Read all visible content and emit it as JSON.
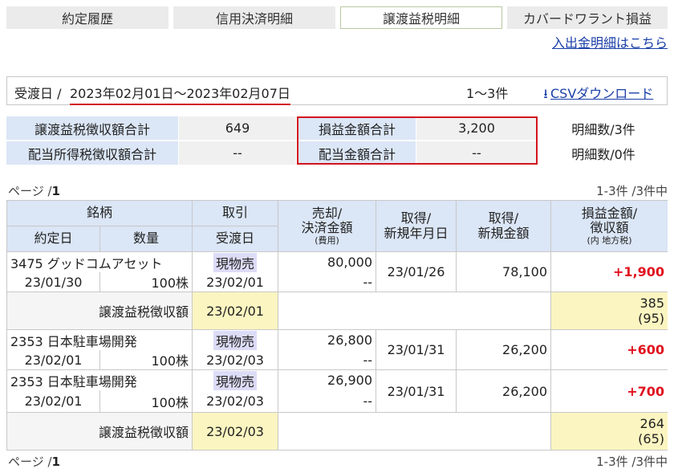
{
  "tabs": [
    {
      "label": "約定履歴"
    },
    {
      "label": "信用決済明細"
    },
    {
      "label": "譲渡益税明細"
    },
    {
      "label": "カバードワラント損益"
    }
  ],
  "links": {
    "deposit": "入出金明細はこちら"
  },
  "period": {
    "label": "受渡日",
    "sep": "/",
    "range": "2023年02月01日～2023年02月07日",
    "count": "1～3件",
    "csv": "CSVダウンロード"
  },
  "summary": {
    "rows": [
      {
        "label1": "譲渡益税徴収額合計",
        "value1": "649",
        "label2": "損益金額合計",
        "value2": "3,200",
        "detail": "明細数/3件"
      },
      {
        "label1": "配当所得税徴収額合計",
        "value1": "--",
        "label2": "配当金額合計",
        "value2": "--",
        "detail": "明細数/0件"
      }
    ]
  },
  "pagination": {
    "page_label": "ページ /",
    "page_num": "1",
    "count": "1-3件 /3件中"
  },
  "table": {
    "headers": {
      "meigara": "銘柄",
      "torihiki": "取引",
      "yakujo_date": "約定日",
      "quantity": "数量",
      "ukewatashi": "受渡日",
      "sell_1": "売却/",
      "sell_2": "決済金額",
      "sell_3": "(費用)",
      "acq_date_1": "取得/",
      "acq_date_2": "新規年月日",
      "acq_amt_1": "取得/",
      "acq_amt_2": "新規金額",
      "pl_1": "損益金額/",
      "pl_2": "徴収額",
      "pl_3": "(内 地方税)"
    },
    "trades": [
      {
        "name": "3475 グッドコムアセット",
        "trade": "現物売",
        "date": "23/01/30",
        "qty": "100株",
        "settle": "23/02/01",
        "sell": "80,000",
        "cost": "--",
        "acq_date": "23/01/26",
        "acq_amt": "78,100",
        "pl": "+1,900"
      },
      {
        "name": "2353 日本駐車場開発",
        "trade": "現物売",
        "date": "23/02/01",
        "qty": "100株",
        "settle": "23/02/03",
        "sell": "26,800",
        "cost": "--",
        "acq_date": "23/01/31",
        "acq_amt": "26,200",
        "pl": "+600"
      },
      {
        "name": "2353 日本駐車場開発",
        "trade": "現物売",
        "date": "23/02/01",
        "qty": "100株",
        "settle": "23/02/03",
        "sell": "26,900",
        "cost": "--",
        "acq_date": "23/01/31",
        "acq_amt": "26,200",
        "pl": "+700"
      }
    ],
    "tax_rows": [
      {
        "label": "譲渡益税徴収額",
        "date": "23/02/01",
        "amount": "385",
        "local": "(95)"
      },
      {
        "label": "譲渡益税徴収額",
        "date": "23/02/03",
        "amount": "264",
        "local": "(65)"
      }
    ]
  }
}
